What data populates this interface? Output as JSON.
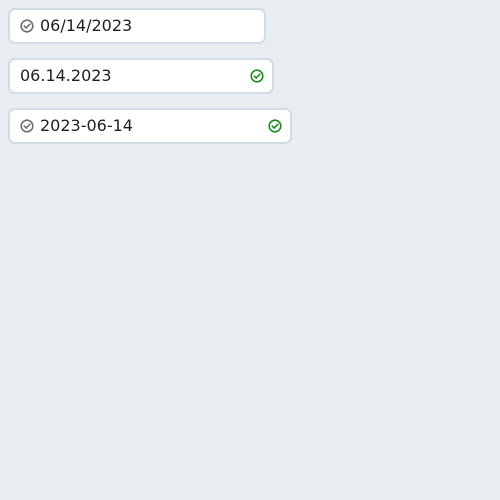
{
  "fields": [
    {
      "value": "06/14/2023",
      "leading_icon": "check-circle-icon"
    },
    {
      "value": "06.14.2023",
      "trailing_icon": "check-circle-icon",
      "status": "valid"
    },
    {
      "value": "2023-06-14",
      "leading_icon": "check-circle-icon",
      "trailing_icon": "check-circle-icon",
      "status": "valid"
    }
  ],
  "colors": {
    "background": "#e8edf2",
    "field_border": "#d3dbe4",
    "field_background": "#ffffff",
    "text": "#1f1f1f",
    "icon_muted": "#6b6f75",
    "icon_valid": "#1e8a1e"
  }
}
